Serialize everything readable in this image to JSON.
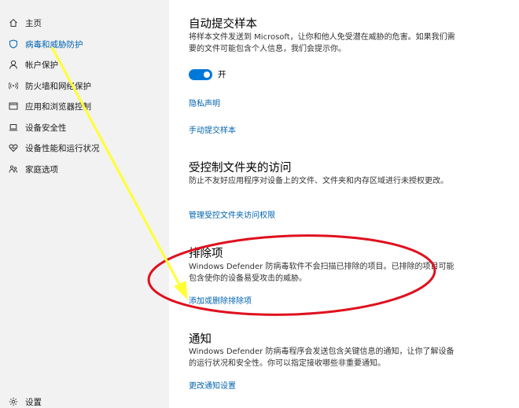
{
  "sidebar": {
    "items": [
      {
        "label": "主页",
        "icon": "home-icon"
      },
      {
        "label": "病毒和威胁防护",
        "icon": "shield-icon"
      },
      {
        "label": "帐户保护",
        "icon": "person-icon"
      },
      {
        "label": "防火墙和网络保护",
        "icon": "wifi-icon"
      },
      {
        "label": "应用和浏览器控制",
        "icon": "browser-window-icon"
      },
      {
        "label": "设备安全性",
        "icon": "laptop-icon"
      },
      {
        "label": "设备性能和运行状况",
        "icon": "heart-icon"
      },
      {
        "label": "家庭选项",
        "icon": "family-icon"
      }
    ],
    "settings_label": "设置"
  },
  "sample": {
    "title": "自动提交样本",
    "description": "将样本文件发送到 Microsoft，让你和他人免受潜在威胁的危害。如果我们需要的文件可能包含个人信息，我们会提示你。",
    "toggle_state": "开",
    "privacy_link": "隐私声明",
    "manual_link": "手动提交样本"
  },
  "cfa": {
    "title": "受控制文件夹的访问",
    "description": "防止不友好应用程序对设备上的文件、文件夹和内存区域进行未授权更改。",
    "link": "管理受控文件夹访问权限"
  },
  "exclusions": {
    "title": "排除项",
    "description": "Windows Defender 防病毒软件不会扫描已排除的项目。已排除的项目可能包含使你的设备易受攻击的威胁。",
    "link": "添加或删除排除项"
  },
  "notifications": {
    "title": "通知",
    "description": "Windows Defender 防病毒程序会发送包含关键信息的通知，让你了解设备的运行状况和安全性。你可以指定接收哪些非重要通知。",
    "link": "更改通知设置"
  },
  "colors": {
    "accent": "#0063b1",
    "annotation_red": "#e0101e",
    "annotation_yellow": "#ffff33"
  }
}
